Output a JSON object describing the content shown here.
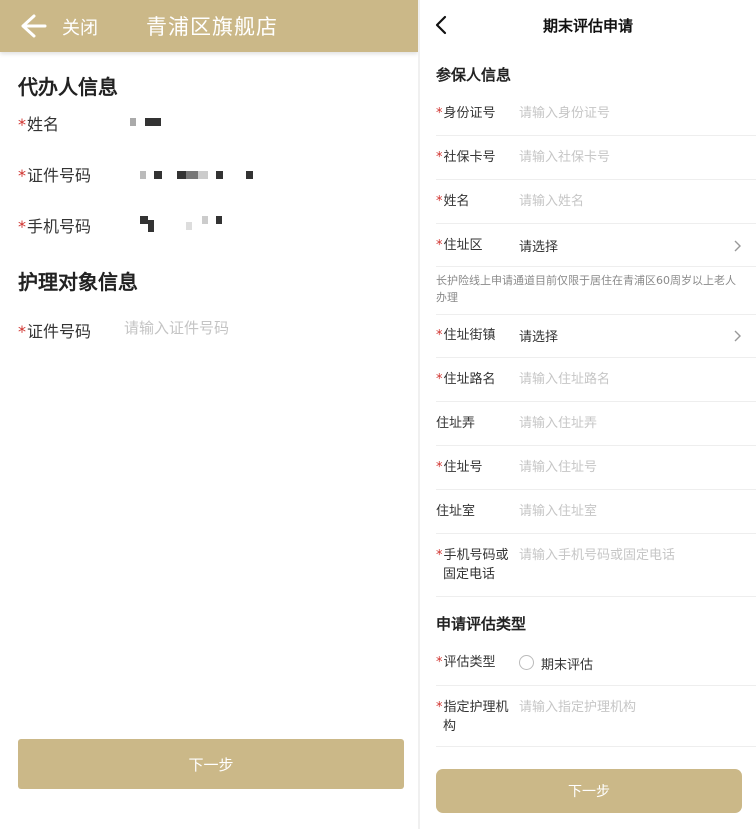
{
  "left": {
    "header": {
      "close_label": "关闭",
      "title": "青浦区旗舰店"
    },
    "agent_section": {
      "title": "代办人信息",
      "fields": [
        {
          "required": "*",
          "label": "姓名"
        },
        {
          "required": "*",
          "label": "证件号码"
        },
        {
          "required": "*",
          "label": "手机号码"
        }
      ]
    },
    "care_section": {
      "title": "护理对象信息",
      "id_field": {
        "required": "*",
        "label": "证件号码",
        "placeholder": "请输入证件号码"
      }
    },
    "next_label": "下一步"
  },
  "right": {
    "title": "期末评估申请",
    "insured_section": {
      "title": "参保人信息"
    },
    "fields": {
      "id": {
        "required": "*",
        "label": "身份证号",
        "placeholder": "请输入身份证号"
      },
      "social": {
        "required": "*",
        "label": "社保卡号",
        "placeholder": "请输入社保卡号"
      },
      "name": {
        "required": "*",
        "label": "姓名",
        "placeholder": "请输入姓名"
      },
      "district": {
        "required": "*",
        "label": "住址区",
        "value": "请选择"
      },
      "street": {
        "required": "*",
        "label": "住址街镇",
        "value": "请选择"
      },
      "road": {
        "required": "*",
        "label": "住址路名",
        "placeholder": "请输入住址路名"
      },
      "lane": {
        "label": "住址弄",
        "placeholder": "请输入住址弄"
      },
      "number": {
        "required": "*",
        "label": "住址号",
        "placeholder": "请输入住址号"
      },
      "room": {
        "label": "住址室",
        "placeholder": "请输入住址室"
      },
      "phone": {
        "required": "*",
        "label_line1": "手机号码或",
        "label_line2": "固定电话",
        "placeholder": "请输入手机号码或固定电话"
      }
    },
    "note": "长护险线上申请通道目前仅限于居住在青浦区60周岁以上老人办理",
    "type_section": {
      "title": "申请评估类型",
      "type_field": {
        "required": "*",
        "label": "评估类型",
        "option": "期末评估"
      },
      "institution": {
        "required": "*",
        "label_line1": "指定护理机",
        "label_line2": "构",
        "placeholder": "请输入指定护理机构"
      }
    },
    "next_label": "下一步"
  }
}
